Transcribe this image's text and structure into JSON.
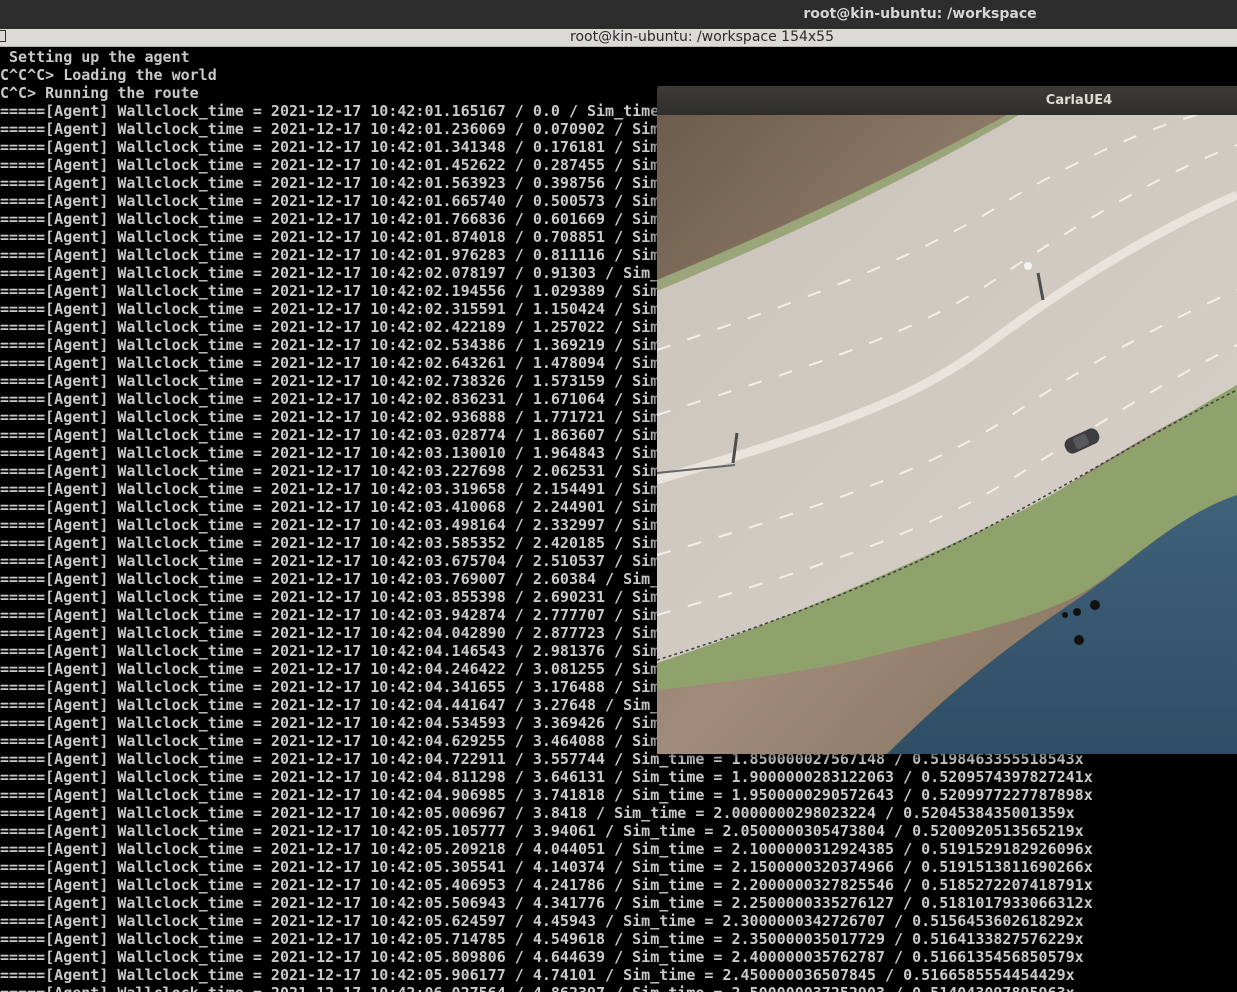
{
  "desktop": {
    "top_title": "root@kin-ubuntu: /workspace"
  },
  "terminal": {
    "title": "root@kin-ubuntu: /workspace 154x55",
    "lines": [
      " Setting up the agent",
      "C^C^C> Loading the world",
      "C^C> Running the route",
      "=====[Agent] Wallclock_time = 2021-12-17 10:42:01.165167 / 0.0 / Sim_time",
      "=====[Agent] Wallclock_time = 2021-12-17 10:42:01.236069 / 0.070902 / Sim",
      "=====[Agent] Wallclock_time = 2021-12-17 10:42:01.341348 / 0.176181 / Sim",
      "=====[Agent] Wallclock_time = 2021-12-17 10:42:01.452622 / 0.287455 / Sim",
      "=====[Agent] Wallclock_time = 2021-12-17 10:42:01.563923 / 0.398756 / Sim",
      "=====[Agent] Wallclock_time = 2021-12-17 10:42:01.665740 / 0.500573 / Sim",
      "=====[Agent] Wallclock_time = 2021-12-17 10:42:01.766836 / 0.601669 / Sim",
      "=====[Agent] Wallclock_time = 2021-12-17 10:42:01.874018 / 0.708851 / Sim",
      "=====[Agent] Wallclock_time = 2021-12-17 10:42:01.976283 / 0.811116 / Sim",
      "=====[Agent] Wallclock_time = 2021-12-17 10:42:02.078197 / 0.91303 / Sim_",
      "=====[Agent] Wallclock_time = 2021-12-17 10:42:02.194556 / 1.029389 / Sim",
      "=====[Agent] Wallclock_time = 2021-12-17 10:42:02.315591 / 1.150424 / Sim",
      "=====[Agent] Wallclock_time = 2021-12-17 10:42:02.422189 / 1.257022 / Sim",
      "=====[Agent] Wallclock_time = 2021-12-17 10:42:02.534386 / 1.369219 / Sim",
      "=====[Agent] Wallclock_time = 2021-12-17 10:42:02.643261 / 1.478094 / Sim",
      "=====[Agent] Wallclock_time = 2021-12-17 10:42:02.738326 / 1.573159 / Sim",
      "=====[Agent] Wallclock_time = 2021-12-17 10:42:02.836231 / 1.671064 / Sim",
      "=====[Agent] Wallclock_time = 2021-12-17 10:42:02.936888 / 1.771721 / Sim",
      "=====[Agent] Wallclock_time = 2021-12-17 10:42:03.028774 / 1.863607 / Sim",
      "=====[Agent] Wallclock_time = 2021-12-17 10:42:03.130010 / 1.964843 / Sim",
      "=====[Agent] Wallclock_time = 2021-12-17 10:42:03.227698 / 2.062531 / Sim",
      "=====[Agent] Wallclock_time = 2021-12-17 10:42:03.319658 / 2.154491 / Sim",
      "=====[Agent] Wallclock_time = 2021-12-17 10:42:03.410068 / 2.244901 / Sim",
      "=====[Agent] Wallclock_time = 2021-12-17 10:42:03.498164 / 2.332997 / Sim",
      "=====[Agent] Wallclock_time = 2021-12-17 10:42:03.585352 / 2.420185 / Sim",
      "=====[Agent] Wallclock_time = 2021-12-17 10:42:03.675704 / 2.510537 / Sim",
      "=====[Agent] Wallclock_time = 2021-12-17 10:42:03.769007 / 2.60384 / Sim_",
      "=====[Agent] Wallclock_time = 2021-12-17 10:42:03.855398 / 2.690231 / Sim",
      "=====[Agent] Wallclock_time = 2021-12-17 10:42:03.942874 / 2.777707 / Sim",
      "=====[Agent] Wallclock_time = 2021-12-17 10:42:04.042890 / 2.877723 / Sim",
      "=====[Agent] Wallclock_time = 2021-12-17 10:42:04.146543 / 2.981376 / Sim",
      "=====[Agent] Wallclock_time = 2021-12-17 10:42:04.246422 / 3.081255 / Sim",
      "=====[Agent] Wallclock_time = 2021-12-17 10:42:04.341655 / 3.176488 / Sim",
      "=====[Agent] Wallclock_time = 2021-12-17 10:42:04.441647 / 3.27648 / Sim_",
      "=====[Agent] Wallclock_time = 2021-12-17 10:42:04.534593 / 3.369426 / Sim",
      "=====[Agent] Wallclock_time = 2021-12-17 10:42:04.629255 / 3.464088 / Sim",
      "=====[Agent] Wallclock_time = 2021-12-17 10:42:04.722911 / 3.557744 / Sim_time = 1.850000027567148 / 0.5198463355518543x",
      "=====[Agent] Wallclock_time = 2021-12-17 10:42:04.811298 / 3.646131 / Sim_time = 1.9000000283122063 / 0.5209574397827241x",
      "=====[Agent] Wallclock_time = 2021-12-17 10:42:04.906985 / 3.741818 / Sim_time = 1.9500000290572643 / 0.5209977227787898x",
      "=====[Agent] Wallclock_time = 2021-12-17 10:42:05.006967 / 3.8418 / Sim_time = 2.0000000298023224 / 0.5204538435001359x",
      "=====[Agent] Wallclock_time = 2021-12-17 10:42:05.105777 / 3.94061 / Sim_time = 2.0500000305473804 / 0.5200920513565219x",
      "=====[Agent] Wallclock_time = 2021-12-17 10:42:05.209218 / 4.044051 / Sim_time = 2.1000000312924385 / 0.5191529182926096x",
      "=====[Agent] Wallclock_time = 2021-12-17 10:42:05.305541 / 4.140374 / Sim_time = 2.1500000320374966 / 0.5191513811690266x",
      "=====[Agent] Wallclock_time = 2021-12-17 10:42:05.406953 / 4.241786 / Sim_time = 2.2000000327825546 / 0.5185272207418791x",
      "=====[Agent] Wallclock_time = 2021-12-17 10:42:05.506943 / 4.341776 / Sim_time = 2.2500000335276127 / 0.5181017933066312x",
      "=====[Agent] Wallclock_time = 2021-12-17 10:42:05.624597 / 4.45943 / Sim_time = 2.3000000342726707 / 0.5156453602618292x",
      "=====[Agent] Wallclock_time = 2021-12-17 10:42:05.714785 / 4.549618 / Sim_time = 2.350000035017729 / 0.5164133827576229x",
      "=====[Agent] Wallclock_time = 2021-12-17 10:42:05.809806 / 4.644639 / Sim_time = 2.400000035762787 / 0.5166135456850579x",
      "=====[Agent] Wallclock_time = 2021-12-17 10:42:05.906177 / 4.74101 / Sim_time = 2.450000036507845 / 0.5166585554454429x",
      "=====[Agent] Wallclock_time = 2021-12-17 10:42:06.027564 / 4.862397 / Sim_time = 2.500000037252903 / 0.514043097895963x"
    ]
  },
  "carla": {
    "title": "CarlaUE4"
  }
}
